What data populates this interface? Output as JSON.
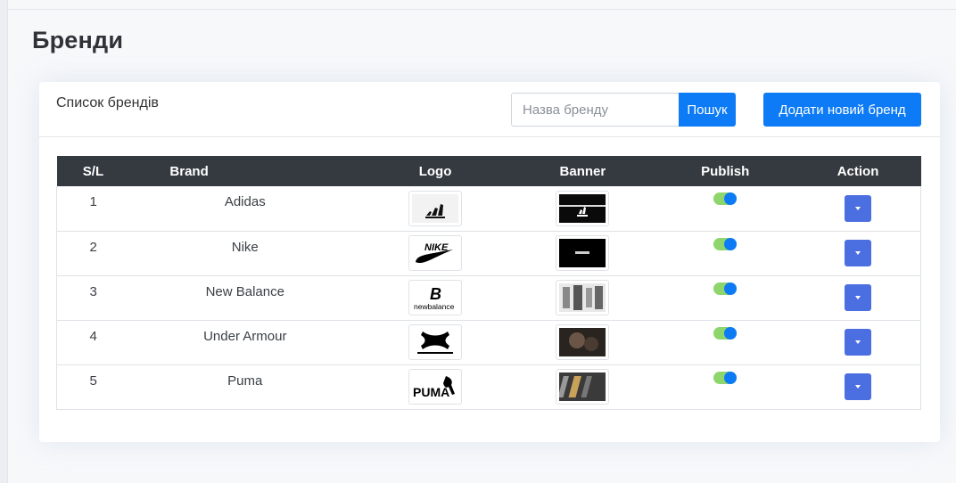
{
  "page": {
    "title": "Бренди"
  },
  "card": {
    "title": "Список брендів",
    "search": {
      "placeholder": "Назва бренду",
      "value": "",
      "button_label": "Пошук"
    },
    "add_button_label": "Додати новий бренд"
  },
  "table": {
    "headers": {
      "sl": "S/L",
      "brand": "Brand",
      "logo": "Logo",
      "banner": "Banner",
      "publish": "Publish",
      "action": "Action"
    },
    "rows": [
      {
        "sl": "1",
        "brand": "Adidas",
        "logo_icon": "adidas-logo",
        "banner_icon": "adidas-banner",
        "published": true
      },
      {
        "sl": "2",
        "brand": "Nike",
        "logo_icon": "nike-logo",
        "banner_icon": "nike-banner",
        "published": true
      },
      {
        "sl": "3",
        "brand": "New Balance",
        "logo_icon": "new-balance-logo",
        "logo_text": "newbalance",
        "banner_icon": "new-balance-banner",
        "published": true
      },
      {
        "sl": "4",
        "brand": "Under Armour",
        "logo_icon": "under-armour-logo",
        "banner_icon": "under-armour-banner",
        "published": true
      },
      {
        "sl": "5",
        "brand": "Puma",
        "logo_icon": "puma-logo",
        "logo_text": "PUMA",
        "banner_icon": "puma-banner",
        "published": true
      }
    ]
  },
  "colors": {
    "primary": "#0d7bf5",
    "header_bg": "#343a40",
    "toggle_track": "#8ed66b",
    "action": "#4b6fe0"
  }
}
